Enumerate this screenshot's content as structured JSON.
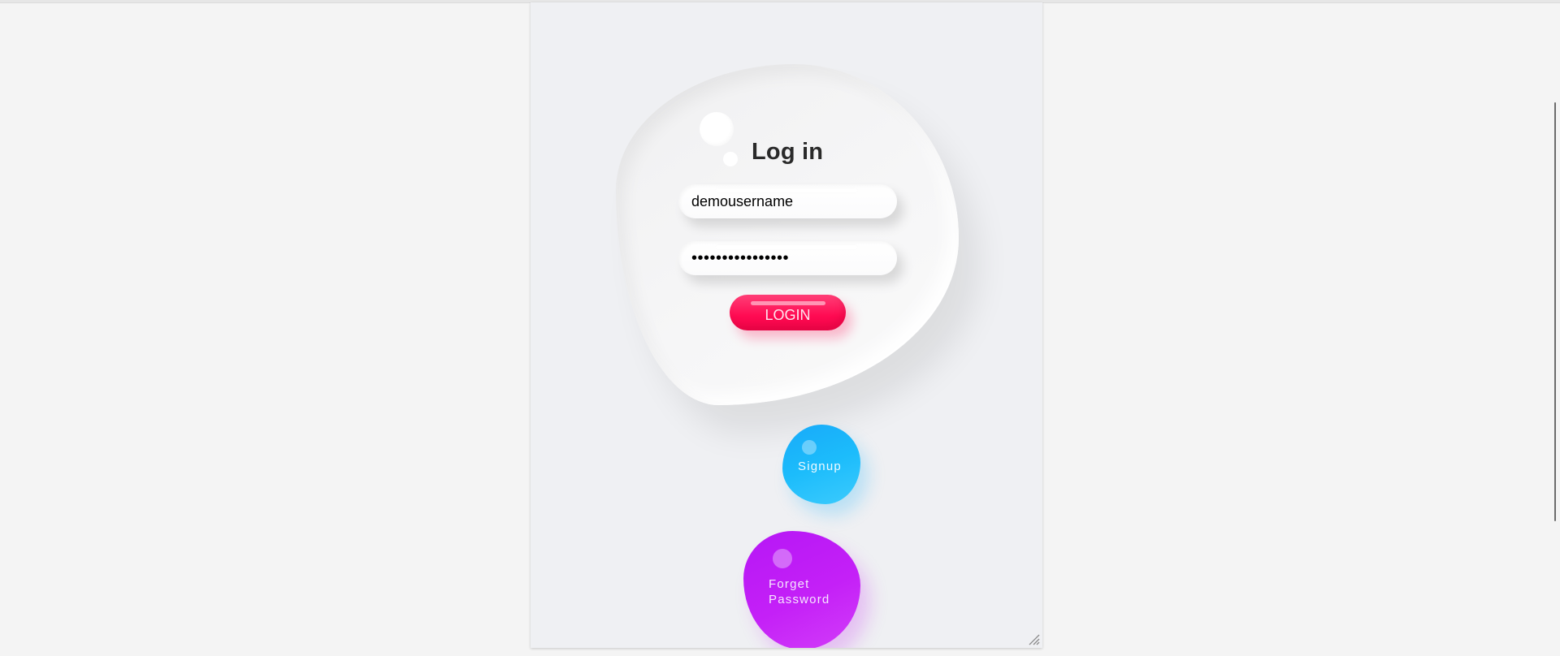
{
  "login": {
    "title": "Log in",
    "username_value": "demousername",
    "password_value": "dummypassword123",
    "button_label": "LOGIN"
  },
  "links": {
    "signup_label": "Signup",
    "forget_line1": "Forget",
    "forget_line2": "Password"
  },
  "colors": {
    "page_background": "#f4f4f4",
    "panel_background": "#eff0f3",
    "login_button": "#ff1a5e",
    "signup_blob": "#1cb6fa",
    "forget_blob": "#c21ff6"
  },
  "icons": {
    "resize_grip": "resize-grip-icon"
  }
}
